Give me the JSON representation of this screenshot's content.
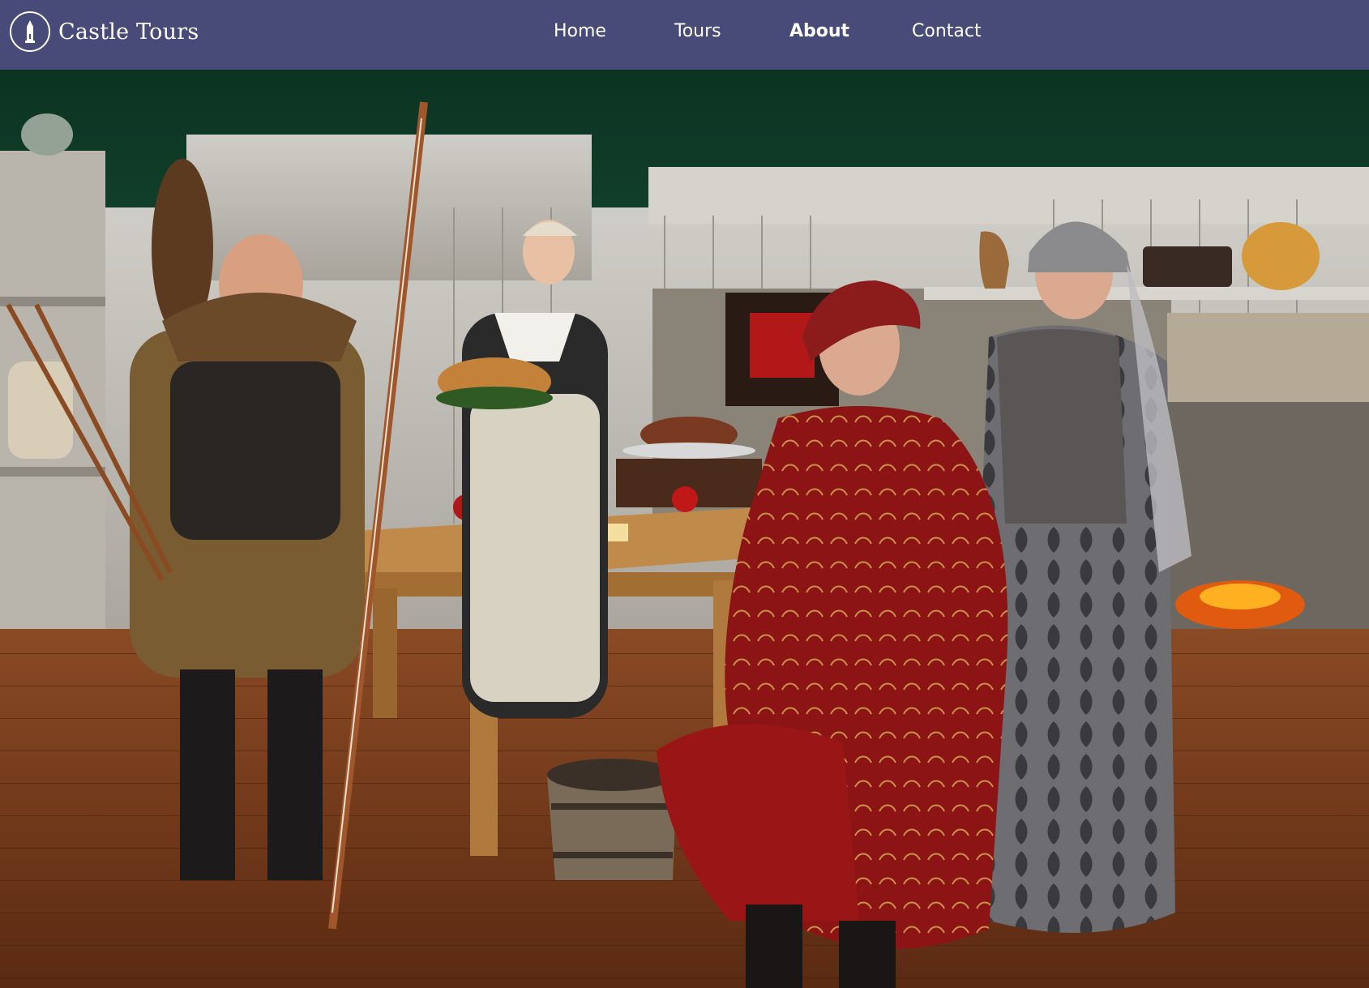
{
  "brand": {
    "name": "Castle Tours",
    "logo_icon": "castle-tower-icon"
  },
  "nav": [
    {
      "label": "Home",
      "active": false
    },
    {
      "label": "Tours",
      "active": false
    },
    {
      "label": "About",
      "active": true
    },
    {
      "label": "Contact",
      "active": false
    }
  ],
  "colors": {
    "navbar": "#484a78",
    "nav_text": "#ffffff",
    "wall": "#0f3a26"
  }
}
